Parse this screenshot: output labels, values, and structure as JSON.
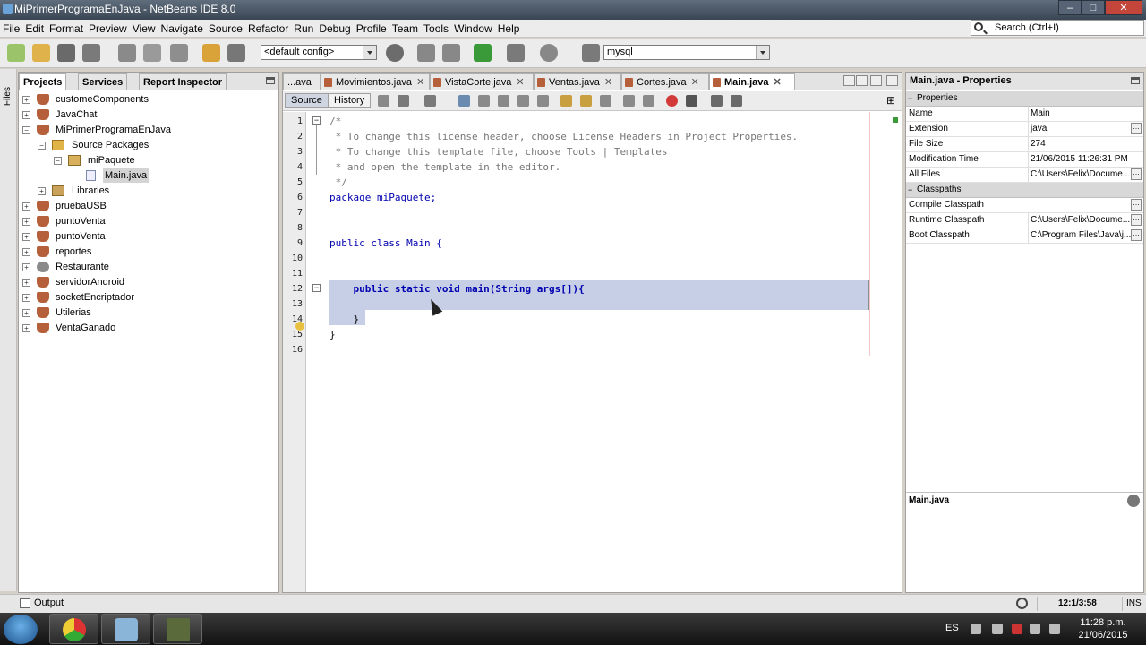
{
  "window": {
    "title": "MiPrimerProgramaEnJava - NetBeans IDE 8.0"
  },
  "menu": {
    "items": [
      "File",
      "Edit",
      "Format",
      "Preview",
      "View",
      "Navigate",
      "Source",
      "Refactor",
      "Run",
      "Debug",
      "Profile",
      "Team",
      "Tools",
      "Window",
      "Help"
    ]
  },
  "search": {
    "placeholder": "Search (Ctrl+I)"
  },
  "toolbar": {
    "config_value": "<default config>",
    "db_value": "mysql"
  },
  "left_strip": {
    "label": "Files"
  },
  "projects_panel": {
    "tabs": [
      "Projects",
      "Services",
      "Report Inspector"
    ],
    "tree": [
      {
        "label": "customeComponents"
      },
      {
        "label": "JavaChat"
      },
      {
        "label": "MiPrimerProgramaEnJava"
      },
      {
        "label": "Source Packages"
      },
      {
        "label": "miPaquete"
      },
      {
        "label": "Main.java"
      },
      {
        "label": "Libraries"
      },
      {
        "label": "pruebaUSB"
      },
      {
        "label": "puntoVenta"
      },
      {
        "label": "puntoVenta"
      },
      {
        "label": "reportes"
      },
      {
        "label": "Restaurante"
      },
      {
        "label": "servidorAndroid"
      },
      {
        "label": "socketEncriptador"
      },
      {
        "label": "Utilerias"
      },
      {
        "label": "VentaGanado"
      }
    ]
  },
  "editor": {
    "tabs": [
      "...ava",
      "Movimientos.java",
      "VistaCorte.java",
      "Ventas.java",
      "Cortes.java",
      "Main.java"
    ],
    "active_tab": "Main.java",
    "source_btn": "Source",
    "history_btn": "History",
    "line_numbers": [
      "1",
      "2",
      "3",
      "4",
      "5",
      "6",
      "7",
      "8",
      "9",
      "10",
      "11",
      "12",
      "13",
      "14",
      "15",
      "16"
    ],
    "lines": [
      "/*",
      " * To change this license header, choose License Headers in Project Properties.",
      " * To change this template file, choose Tools | Templates",
      " * and open the template in the editor.",
      " */",
      "package miPaquete;",
      "",
      "",
      "public class Main {",
      "",
      "",
      "    public static void main(String args[]){",
      "",
      "    }",
      "}",
      ""
    ]
  },
  "properties": {
    "title": "Main.java - Properties",
    "section1": "Properties",
    "rows1": [
      {
        "key": "Name",
        "value": "Main"
      },
      {
        "key": "Extension",
        "value": "java"
      },
      {
        "key": "File Size",
        "value": "274"
      },
      {
        "key": "Modification Time",
        "value": "21/06/2015 11:26:31 PM"
      },
      {
        "key": "All Files",
        "value": "C:\\Users\\Felix\\Docume..."
      }
    ],
    "section2": "Classpaths",
    "rows2": [
      {
        "key": "Compile Classpath",
        "value": ""
      },
      {
        "key": "Runtime Classpath",
        "value": "C:\\Users\\Felix\\Docume..."
      },
      {
        "key": "Boot Classpath",
        "value": "C:\\Program Files\\Java\\j..."
      }
    ],
    "footer_title": "Main.java"
  },
  "status": {
    "output_label": "Output",
    "position": "12:1/3:58",
    "mode": "INS"
  },
  "taskbar": {
    "language": "ES",
    "time": "11:28 p.m.",
    "date": "21/06/2015"
  }
}
